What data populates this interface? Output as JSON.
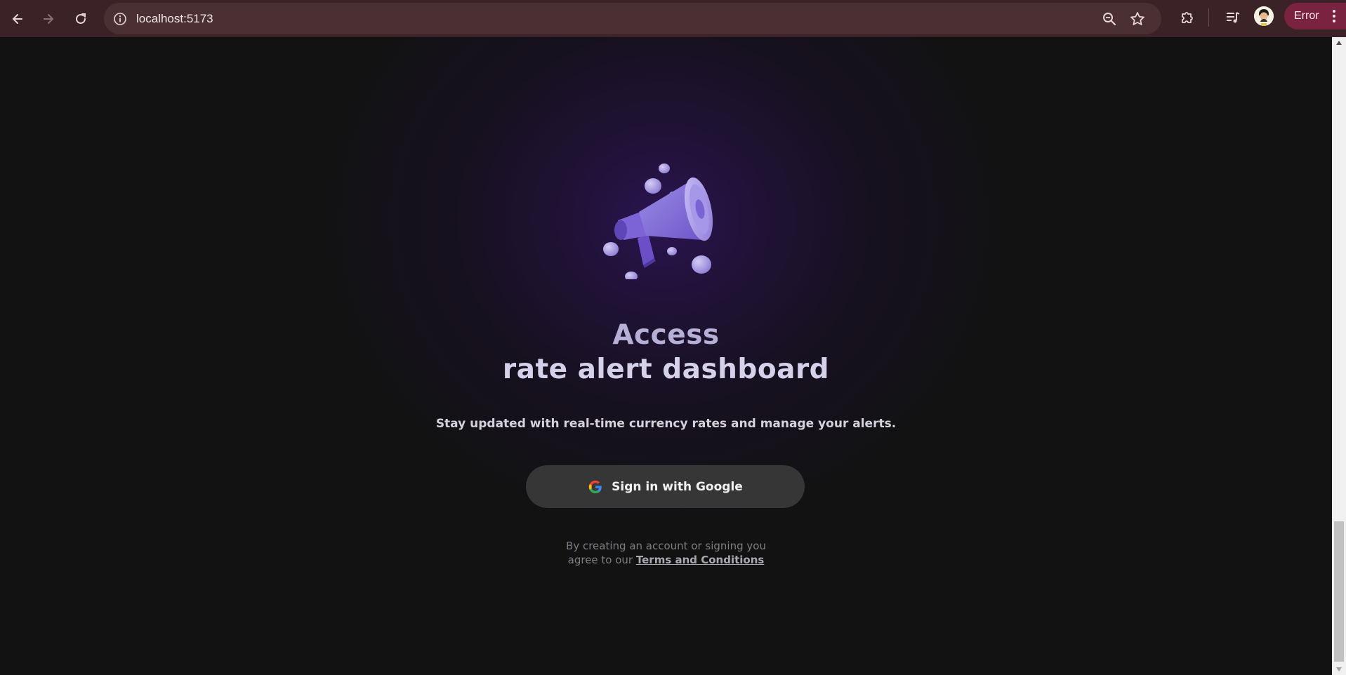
{
  "browser": {
    "url": "localhost:5173",
    "profile_status": "Error",
    "icons": {
      "back": "back-arrow-icon",
      "forward": "forward-arrow-icon",
      "reload": "reload-icon",
      "site_info": "info-icon",
      "zoom": "zoom-icon",
      "bookmark": "star-icon",
      "extensions": "puzzle-icon",
      "media": "media-queue-icon",
      "menu": "kebab-icon"
    },
    "colors": {
      "frame": "#3a2226",
      "omnibox": "#4a2f33",
      "error_pill": "#7a2340"
    }
  },
  "page": {
    "illustration": "megaphone-illustration",
    "title_line1": "Access",
    "title_line2": "rate alert dashboard",
    "subtitle": "Stay updated with real-time currency rates and manage your alerts.",
    "signin_button_label": "Sign in with Google",
    "legal_line1": "By creating an account or signing you",
    "legal_line2_prefix": "agree to our",
    "terms_link": "Terms and Conditions",
    "colors": {
      "background": "#121212",
      "glow": "#2c1454",
      "button": "#363636",
      "accent": "#7b5cd6"
    }
  }
}
